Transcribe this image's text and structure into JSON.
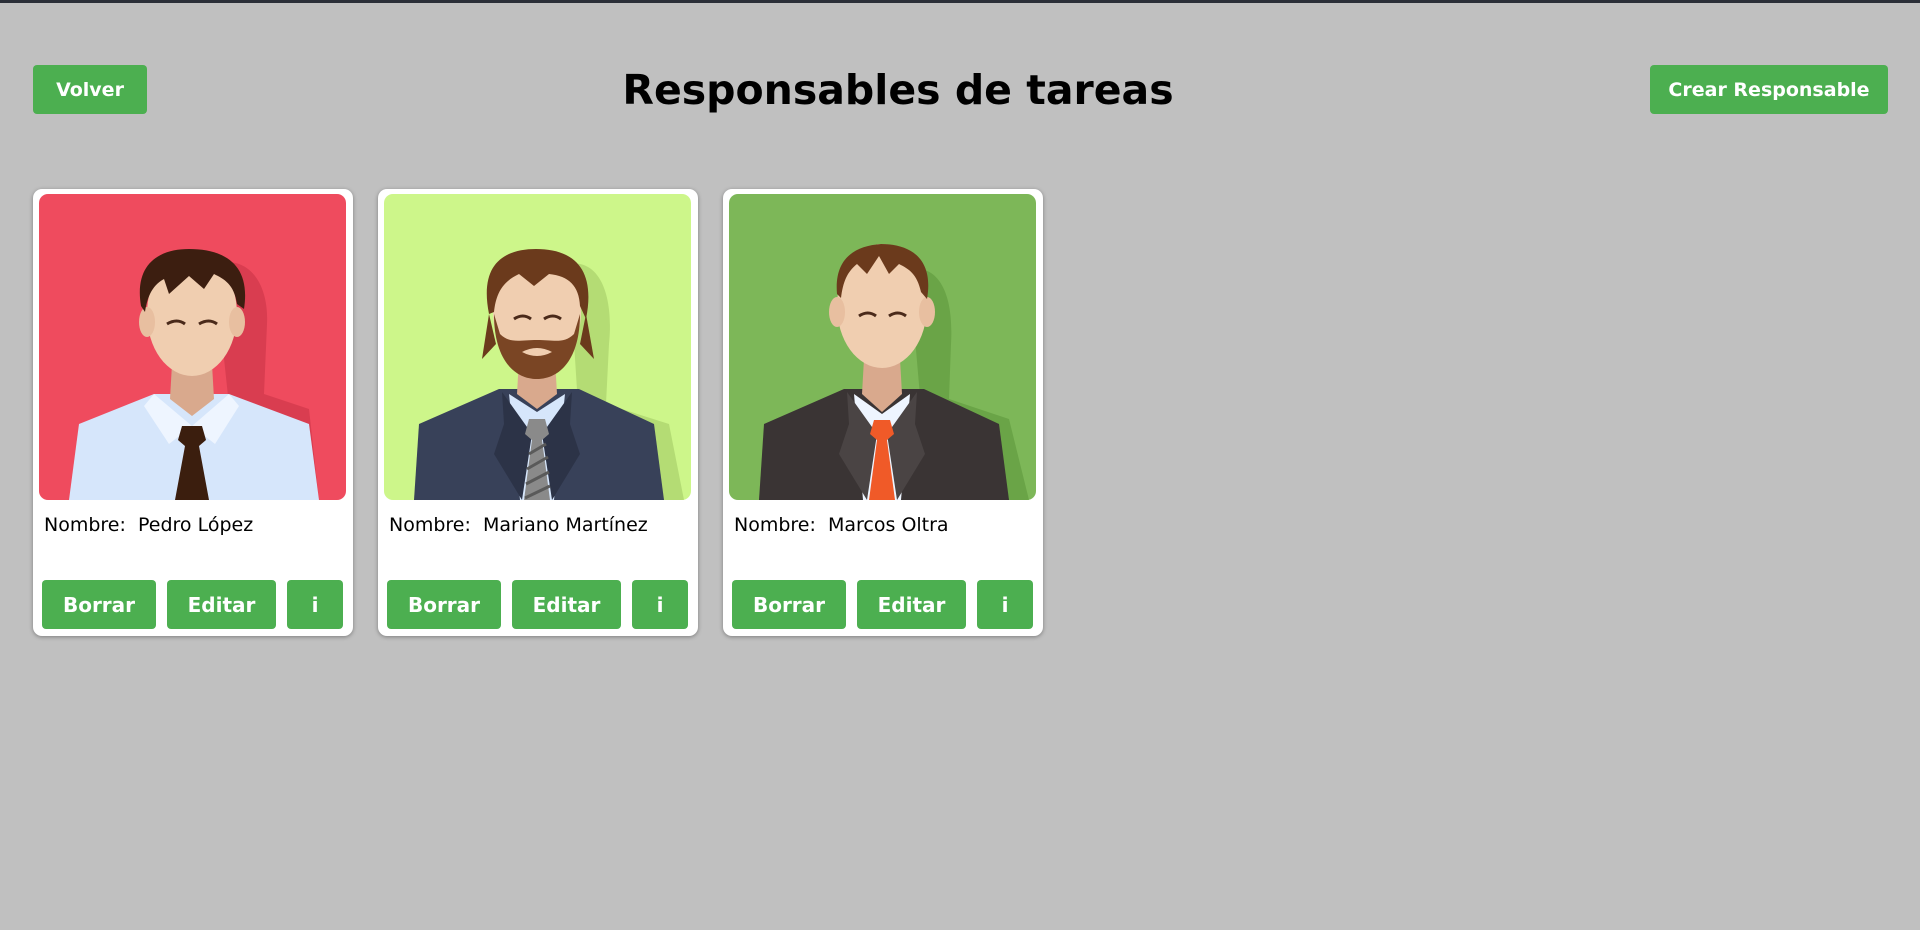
{
  "header": {
    "back_label": "Volver",
    "title": "Responsables de tareas",
    "create_label": "Crear Responsable"
  },
  "cards": [
    {
      "name_label": "Nombre:",
      "name": "Pedro López",
      "delete_label": "Borrar",
      "edit_label": "Editar",
      "info_label": "i",
      "avatar_icon": "man-avatar-icon",
      "avatar_bg": "#ef4b5e"
    },
    {
      "name_label": "Nombre:",
      "name": "Mariano Martínez",
      "delete_label": "Borrar",
      "edit_label": "Editar",
      "info_label": "i",
      "avatar_icon": "bearded-man-avatar-icon",
      "avatar_bg": "#cdf68a"
    },
    {
      "name_label": "Nombre:",
      "name": "Marcos Oltra",
      "delete_label": "Borrar",
      "edit_label": "Editar",
      "info_label": "i",
      "avatar_icon": "man-suit-avatar-icon",
      "avatar_bg": "#7db758"
    }
  ],
  "colors": {
    "accent": "#4caf50",
    "page_bg": "#c0c0c0"
  }
}
